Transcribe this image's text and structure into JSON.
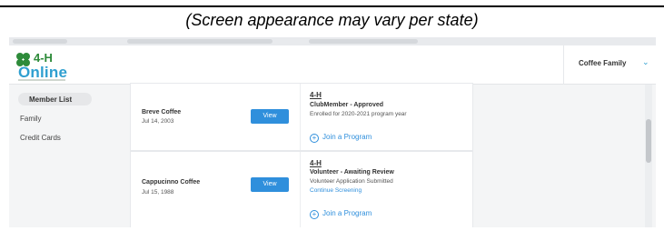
{
  "caption": "(Screen appearance may vary per state)",
  "header": {
    "logo_top": "4-H",
    "logo_bottom": "Online",
    "family_name": "Coffee Family"
  },
  "sidebar": {
    "items": [
      {
        "label": "Member List"
      },
      {
        "label": "Family"
      },
      {
        "label": "Credit Cards"
      }
    ]
  },
  "members": [
    {
      "name": "Breve Coffee",
      "dob": "Jul 14, 2003",
      "view_label": "View",
      "club": "4-H",
      "role_status": "ClubMember - Approved",
      "note": "Enrolled for 2020-2021 program year",
      "link": "",
      "join_label": "Join a Program"
    },
    {
      "name": "Cappucinno Coffee",
      "dob": "Jul 15, 1988",
      "view_label": "View",
      "club": "4-H",
      "role_status": "Volunteer - Awaiting Review",
      "note": "Volunteer Application Submitted",
      "link": "Continue Screening",
      "join_label": "Join a Program"
    }
  ],
  "colors": {
    "accent": "#2f8fdc",
    "brand_green": "#2e8b3a",
    "brand_blue": "#2f9fd0"
  },
  "icons": {
    "logo": "four-h-clover-logo",
    "dropdown": "chevron-down-icon",
    "join": "plus-circle-icon"
  }
}
